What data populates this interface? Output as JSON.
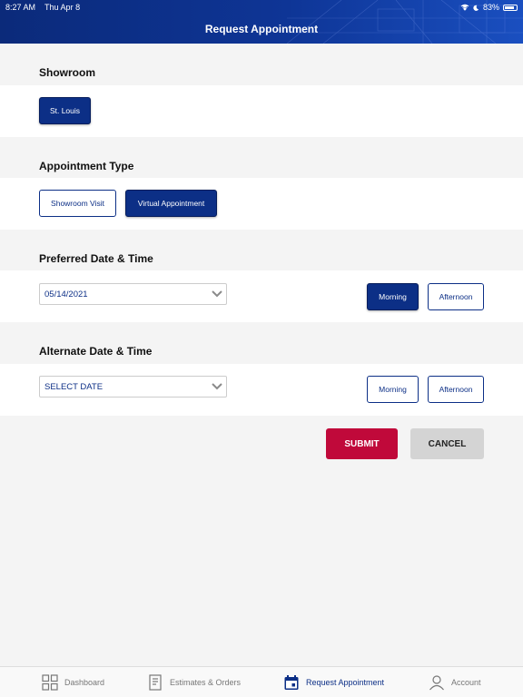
{
  "status_bar": {
    "time": "8:27 AM",
    "date": "Thu Apr 8",
    "battery": "83%"
  },
  "header": {
    "title": "Request Appointment"
  },
  "showroom": {
    "title": "Showroom",
    "option": "St. Louis"
  },
  "appointment_type": {
    "title": "Appointment Type",
    "options": [
      "Showroom Visit",
      "Virtual Appointment"
    ],
    "selected": "Virtual Appointment"
  },
  "preferred": {
    "title": "Preferred Date & Time",
    "date_value": "05/14/2021",
    "morning": "Morning",
    "afternoon": "Afternoon",
    "selected_time": "Morning"
  },
  "alternate": {
    "title": "Alternate Date & Time",
    "date_placeholder": "SELECT DATE",
    "morning": "Morning",
    "afternoon": "Afternoon"
  },
  "actions": {
    "submit": "SUBMIT",
    "cancel": "CANCEL"
  },
  "tabs": [
    {
      "label": "Dashboard",
      "icon": "grid-icon"
    },
    {
      "label": "Estimates & Orders",
      "icon": "document-icon"
    },
    {
      "label": "Request Appointment",
      "icon": "calendar-icon",
      "active": true
    },
    {
      "label": "Account",
      "icon": "person-icon"
    }
  ],
  "colors": {
    "brand_blue": "#0c2f86",
    "submit_red": "#c0093a",
    "cancel_gray": "#d4d4d4"
  }
}
